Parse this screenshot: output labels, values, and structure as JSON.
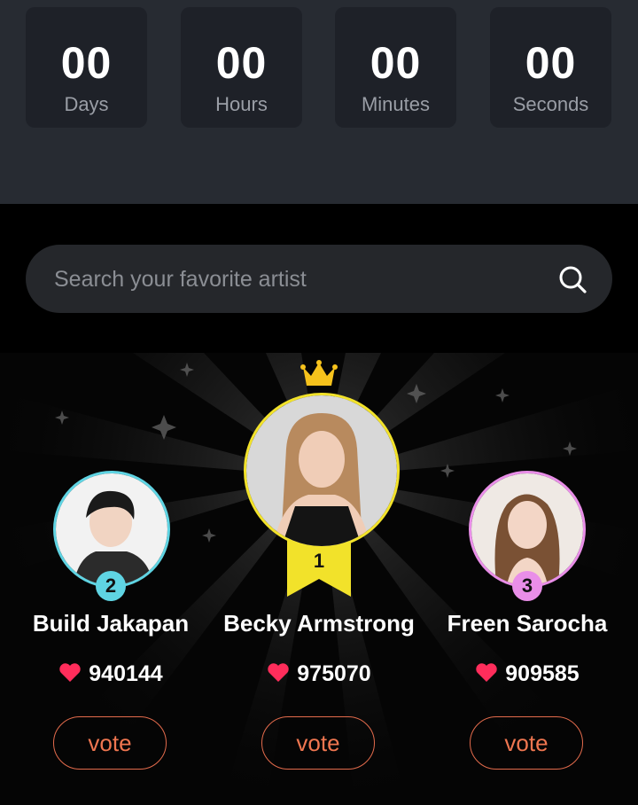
{
  "countdown": [
    {
      "value": "00",
      "label": "Days"
    },
    {
      "value": "00",
      "label": "Hours"
    },
    {
      "value": "00",
      "label": "Minutes"
    },
    {
      "value": "00",
      "label": "Seconds"
    }
  ],
  "search": {
    "placeholder": "Search your favorite artist"
  },
  "podium": {
    "artists": [
      {
        "rank": "2",
        "name": "Build Jakapan",
        "votes": "940144",
        "vote_label": "vote",
        "ring_color": "#5fd4e3"
      },
      {
        "rank": "1",
        "name": "Becky Armstrong",
        "votes": "975070",
        "vote_label": "vote",
        "ring_color": "#f2e22a"
      },
      {
        "rank": "3",
        "name": "Freen Sarocha",
        "votes": "909585",
        "vote_label": "vote",
        "ring_color": "#e98ee8"
      }
    ],
    "heart_color": "#ff2d5b",
    "vote_color": "#ef7650",
    "crown_color": "#f6c21c"
  }
}
